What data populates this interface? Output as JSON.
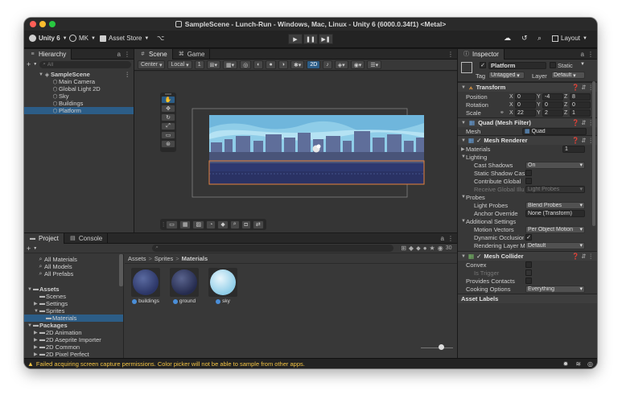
{
  "window": {
    "title": "SampleScene - Lunch-Run - Windows, Mac, Linux - Unity 6 (6000.0.34f1) <Metal>"
  },
  "toolbar": {
    "account": "Unity 6",
    "user": "MK",
    "asset_store": "Asset Store",
    "layout": "Layout",
    "play_icons": [
      "play-icon",
      "pause-icon",
      "step-icon"
    ]
  },
  "hierarchy": {
    "tab": "Hierarchy",
    "search_placeholder": "All",
    "items": [
      {
        "label": "SampleScene",
        "level": 0,
        "selected": false,
        "bold": true
      },
      {
        "label": "Main Camera",
        "level": 1,
        "selected": false
      },
      {
        "label": "Global Light 2D",
        "level": 1,
        "selected": false
      },
      {
        "label": "Sky",
        "level": 1,
        "selected": false
      },
      {
        "label": "Buildings",
        "level": 1,
        "selected": false
      },
      {
        "label": "Platform",
        "level": 1,
        "selected": true
      }
    ]
  },
  "scene": {
    "tabs": [
      "Scene",
      "Game"
    ],
    "pivot": "Center",
    "space": "Local",
    "snap": "1",
    "mode_2d": "2D"
  },
  "project": {
    "tabs": [
      "Project",
      "Console"
    ],
    "favorites": [
      "All Materials",
      "All Models",
      "All Prefabs"
    ],
    "tree": [
      {
        "label": "Assets",
        "level": 0,
        "bold": true,
        "arrow": "▼"
      },
      {
        "label": "Scenes",
        "level": 1,
        "arrow": ""
      },
      {
        "label": "Settings",
        "level": 1,
        "arrow": "▶"
      },
      {
        "label": "Sprites",
        "level": 1,
        "arrow": "▼"
      },
      {
        "label": "Materials",
        "level": 2,
        "arrow": "",
        "selected": true
      },
      {
        "label": "Packages",
        "level": 0,
        "bold": true,
        "arrow": "▼"
      },
      {
        "label": "2D Animation",
        "level": 1,
        "arrow": "▶"
      },
      {
        "label": "2D Aseprite Importer",
        "level": 1,
        "arrow": "▶"
      },
      {
        "label": "2D Common",
        "level": 1,
        "arrow": "▶"
      },
      {
        "label": "2D Pixel Perfect",
        "level": 1,
        "arrow": "▶"
      }
    ],
    "breadcrumb": [
      "Assets",
      "Sprites",
      "Materials"
    ],
    "assets": [
      {
        "name": "buildings"
      },
      {
        "name": "ground"
      },
      {
        "name": "sky"
      }
    ],
    "hidden_count": "30"
  },
  "inspector": {
    "tab": "Inspector",
    "object_name": "Platform",
    "static_label": "Static",
    "tag_label": "Tag",
    "tag": "Untagged",
    "layer_label": "Layer",
    "layer": "Default",
    "transform": {
      "title": "Transform",
      "rows": [
        {
          "label": "Position",
          "x": "0",
          "y": "-4",
          "z": "8"
        },
        {
          "label": "Rotation",
          "x": "0",
          "y": "0",
          "z": "0"
        },
        {
          "label": "Scale",
          "x": "22",
          "y": "2",
          "z": "1"
        }
      ]
    },
    "mesh_filter": {
      "title": "Quad (Mesh Filter)",
      "mesh_label": "Mesh",
      "mesh": "Quad"
    },
    "mesh_renderer": {
      "title": "Mesh Renderer",
      "materials_label": "Materials",
      "materials_count": "1",
      "lighting_label": "Lighting",
      "cast_shadows_label": "Cast Shadows",
      "cast_shadows": "On",
      "static_shadow_caster": "Static Shadow Cas",
      "contribute_gi": "Contribute Global",
      "receive_gi_label": "Receive Global Illu",
      "receive_gi": "Light Probes",
      "probes_label": "Probes",
      "light_probes_label": "Light Probes",
      "light_probes": "Blend Probes",
      "anchor_override_label": "Anchor Override",
      "anchor_override": "None (Transform)",
      "additional_label": "Additional Settings",
      "motion_vectors_label": "Motion Vectors",
      "motion_vectors": "Per Object Motion",
      "dynamic_occlusion_label": "Dynamic Occlusion",
      "rendering_layer_label": "Rendering Layer M",
      "rendering_layer": "Default"
    },
    "mesh_collider": {
      "title": "Mesh Collider",
      "convex": "Convex",
      "is_trigger": "Is Trigger",
      "provides_contacts": "Provides Contacts",
      "cooking_label": "Cooking Options",
      "cooking": "Everything"
    },
    "asset_labels": "Asset Labels"
  },
  "status": {
    "message": "Failed acquiring screen capture permissions. Color picker will not be able to sample from other apps."
  },
  "colors": {
    "accent": "#2c5d87",
    "selection_outline": "#e8823a",
    "panel": "#383838",
    "warning": "#f3c342",
    "traffic": [
      "#ff5f57",
      "#febc2e",
      "#28c840"
    ]
  },
  "chars": {
    "arrow_right": "▶",
    "arrow_down": "▼",
    "check": "✓",
    "menu": "⋮",
    "lock": "a",
    "plus": "+",
    "gear": "⚙",
    "slash": ">"
  }
}
